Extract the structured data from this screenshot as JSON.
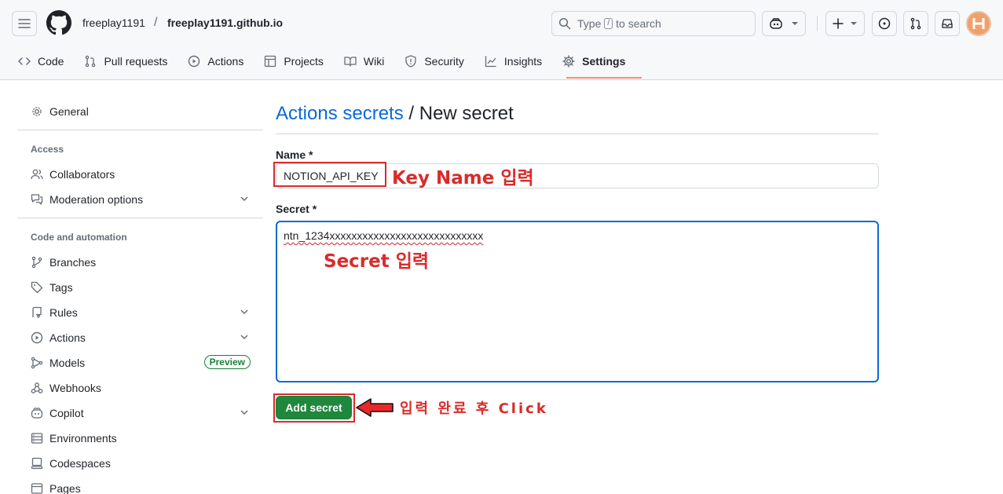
{
  "header": {
    "owner": "freeplay1191",
    "separator": "/",
    "repo": "freeplay1191.github.io",
    "search": {
      "prefix": "Type",
      "key": "/",
      "suffix": "to search"
    }
  },
  "nav": {
    "tabs": [
      {
        "label": "Code",
        "icon": "code-icon"
      },
      {
        "label": "Pull requests",
        "icon": "pull-request-icon"
      },
      {
        "label": "Actions",
        "icon": "play-icon"
      },
      {
        "label": "Projects",
        "icon": "table-icon"
      },
      {
        "label": "Wiki",
        "icon": "book-icon"
      },
      {
        "label": "Security",
        "icon": "shield-icon"
      },
      {
        "label": "Insights",
        "icon": "graph-icon"
      },
      {
        "label": "Settings",
        "icon": "gear-icon"
      }
    ],
    "active": "Settings",
    "active_underline_color": "#fd8c73"
  },
  "sidebar": {
    "general": "General",
    "access_heading": "Access",
    "collaborators": "Collaborators",
    "moderation": "Moderation options",
    "code_heading": "Code and automation",
    "branches": "Branches",
    "tags": "Tags",
    "rules": "Rules",
    "actions": "Actions",
    "models": "Models",
    "models_badge": "Preview",
    "webhooks": "Webhooks",
    "copilot": "Copilot",
    "environments": "Environments",
    "codespaces": "Codespaces",
    "pages": "Pages"
  },
  "main": {
    "title_link": "Actions secrets",
    "title_rest": " / New secret",
    "name_label": "Name *",
    "name_value": "NOTION_API_KEY",
    "secret_label": "Secret *",
    "secret_value": "ntn_1234xxxxxxxxxxxxxxxxxxxxxxxxxxxx",
    "add_button": "Add secret"
  },
  "annotations": {
    "key_name": "Key Name 입력",
    "secret": "Secret 입력",
    "click": "입력 완료 후 Click",
    "color": "#d92b2b"
  },
  "colors": {
    "link": "#0969da",
    "primary_button": "#1f883d",
    "focus_border": "#0969da"
  }
}
